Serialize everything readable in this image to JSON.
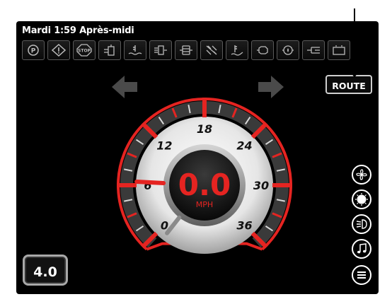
{
  "status": {
    "clock": "Mardi 1:59 Après-midi"
  },
  "warnings": [
    {
      "icon": "parking-brake-icon"
    },
    {
      "icon": "warning-triangle-icon"
    },
    {
      "icon": "stop-icon"
    },
    {
      "icon": "transmission-icon"
    },
    {
      "icon": "coolant-temperature-icon"
    },
    {
      "icon": "hydraulic-icon"
    },
    {
      "icon": "hydraulic-filter-icon"
    },
    {
      "icon": "air-filter-icon"
    },
    {
      "icon": "oil-temperature-icon"
    },
    {
      "icon": "engine-check-icon"
    },
    {
      "icon": "oil-pressure-icon"
    },
    {
      "icon": "glow-plug-icon"
    },
    {
      "icon": "battery-icon"
    }
  ],
  "nav": {
    "left_icon": "arrow-left-icon",
    "right_icon": "arrow-right-icon"
  },
  "route_button": {
    "label": "ROUTE"
  },
  "speedometer": {
    "value": "0.0",
    "unit": "MPH",
    "ticks": [
      "0",
      "6",
      "12",
      "18",
      "24",
      "30",
      "36"
    ],
    "min": 0,
    "max": 36,
    "needle_value": 0,
    "accent": "#e52421"
  },
  "gear": {
    "value": "4.0"
  },
  "side_buttons": [
    {
      "icon": "fan-icon"
    },
    {
      "icon": "work-light-icon"
    },
    {
      "icon": "headlight-icon"
    },
    {
      "icon": "music-icon"
    },
    {
      "icon": "menu-icon"
    }
  ]
}
